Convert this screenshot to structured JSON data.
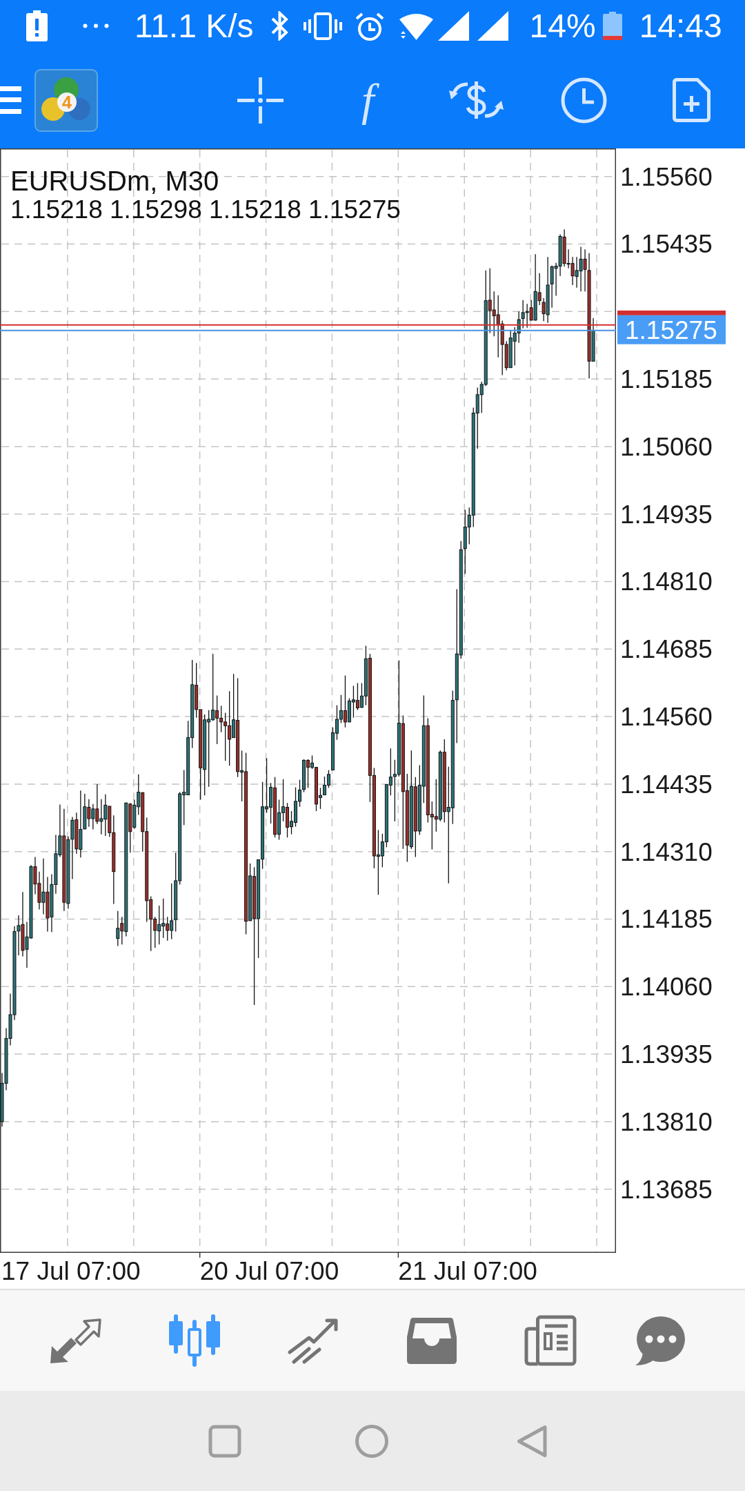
{
  "status_bar": {
    "network_speed": "11.1 K/s",
    "battery_percent": "14%",
    "time": "14:43"
  },
  "toolbar": {
    "logo_badge": "4",
    "function_symbol": "f"
  },
  "chart": {
    "ohlc_readout": "1.15218 1.15298 1.15218 1.15275",
    "time_labels": [
      "17 Jul 07:00",
      "20 Jul 07:00",
      "21 Jul 07:00"
    ],
    "chart_data": {
      "type": "candlestick",
      "title": "EURUSDm, M30",
      "grid": true,
      "categories": [
        null,
        null,
        null,
        null,
        null,
        null,
        null,
        null,
        null,
        null,
        null,
        null,
        null,
        null,
        null,
        null,
        null,
        null,
        null,
        null,
        null,
        null,
        null,
        null,
        null,
        null,
        null,
        null,
        null,
        null,
        null,
        null,
        null,
        null,
        null,
        null,
        null,
        null,
        null,
        null,
        null,
        null,
        null,
        null,
        null,
        null,
        null,
        null,
        null,
        null,
        null,
        null,
        null,
        null,
        null,
        null,
        null,
        null,
        null,
        null,
        null,
        null,
        null,
        null,
        null,
        null,
        null,
        null,
        null,
        null,
        null,
        null,
        null,
        null,
        null,
        null,
        null,
        null,
        null,
        null,
        null,
        null,
        null,
        null,
        null,
        null,
        null,
        null,
        null,
        null,
        null,
        null,
        null,
        null,
        null,
        null,
        null,
        null,
        null,
        null,
        null,
        null,
        null,
        null,
        null,
        null,
        null,
        null,
        null,
        null,
        null,
        null,
        null,
        null,
        null,
        null,
        null,
        null,
        null,
        null,
        null,
        null,
        null,
        null,
        null,
        null,
        null,
        null,
        null,
        null,
        null,
        null,
        null,
        null,
        null,
        null,
        null,
        null,
        null,
        null,
        null,
        null,
        null,
        null,
        null,
        null,
        null,
        null,
        null
      ],
      "ohlc": [
        [
          1.1381,
          1.139,
          1.13801,
          1.13881
        ],
        [
          1.13881,
          1.13983,
          1.13868,
          1.13964
        ],
        [
          1.13964,
          1.14047,
          1.13951,
          1.14008
        ],
        [
          1.14008,
          1.14172,
          1.13998,
          1.14162
        ],
        [
          1.14163,
          1.14192,
          1.14118,
          1.14173
        ],
        [
          1.14175,
          1.14235,
          1.14116,
          1.14127
        ],
        [
          1.14129,
          1.1418,
          1.14095,
          1.14152
        ],
        [
          1.1415,
          1.14285,
          1.14149,
          1.14282
        ],
        [
          1.14282,
          1.143,
          1.14231,
          1.1425
        ],
        [
          1.14251,
          1.14273,
          1.14203,
          1.14216
        ],
        [
          1.14216,
          1.14297,
          1.14194,
          1.14235
        ],
        [
          1.14235,
          1.14263,
          1.14162,
          1.14187
        ],
        [
          1.14189,
          1.14268,
          1.14161,
          1.14249
        ],
        [
          1.14249,
          1.14341,
          1.14232,
          1.14306
        ],
        [
          1.14304,
          1.14397,
          1.143,
          1.14339
        ],
        [
          1.14339,
          1.14389,
          1.142,
          1.14216
        ],
        [
          1.14214,
          1.14338,
          1.14204,
          1.14332
        ],
        [
          1.14333,
          1.14374,
          1.14259,
          1.14368
        ],
        [
          1.14369,
          1.14382,
          1.14306,
          1.14315
        ],
        [
          1.14314,
          1.14423,
          1.14299,
          1.14351
        ],
        [
          1.14352,
          1.14417,
          1.14351,
          1.14393
        ],
        [
          1.14392,
          1.14407,
          1.14356,
          1.14371
        ],
        [
          1.14371,
          1.14398,
          1.14351,
          1.14389
        ],
        [
          1.14389,
          1.14435,
          1.14361,
          1.14366
        ],
        [
          1.14366,
          1.14407,
          1.14342,
          1.14371
        ],
        [
          1.1437,
          1.14416,
          1.14339,
          1.14396
        ],
        [
          1.14394,
          1.14394,
          1.14337,
          1.14345
        ],
        [
          1.14345,
          1.14377,
          1.14213,
          1.14273
        ],
        [
          1.14149,
          1.142,
          1.14135,
          1.14168
        ],
        [
          1.14177,
          1.14189,
          1.14138,
          1.14163
        ],
        [
          1.14162,
          1.14401,
          1.14153,
          1.144
        ],
        [
          1.14398,
          1.144,
          1.14308,
          1.14347
        ],
        [
          1.14355,
          1.14406,
          1.14352,
          1.14396
        ],
        [
          1.14393,
          1.14453,
          1.14378,
          1.1442
        ],
        [
          1.14419,
          1.1442,
          1.1431,
          1.14347
        ],
        [
          1.14347,
          1.14373,
          1.1418,
          1.14219
        ],
        [
          1.14221,
          1.14227,
          1.14126,
          1.14185
        ],
        [
          1.14185,
          1.14189,
          1.14132,
          1.14164
        ],
        [
          1.14163,
          1.1421,
          1.14138,
          1.14175
        ],
        [
          1.14172,
          1.14223,
          1.1415,
          1.14177
        ],
        [
          1.14176,
          1.14189,
          1.14145,
          1.14164
        ],
        [
          1.14164,
          1.14251,
          1.14148,
          1.14182
        ],
        [
          1.14184,
          1.14308,
          1.14162,
          1.14256
        ],
        [
          1.14256,
          1.1442,
          1.14249,
          1.14417
        ],
        [
          1.14415,
          1.14461,
          1.14359,
          1.1442
        ],
        [
          1.14415,
          1.14552,
          1.14415,
          1.14521
        ],
        [
          1.14521,
          1.14665,
          1.14502,
          1.14619
        ],
        [
          1.14618,
          1.14659,
          1.14558,
          1.14573
        ],
        [
          1.14573,
          1.14573,
          1.14406,
          1.14465
        ],
        [
          1.14462,
          1.14564,
          1.14414,
          1.14554
        ],
        [
          1.1455,
          1.14572,
          1.1443,
          1.14555
        ],
        [
          1.14554,
          1.14676,
          1.14552,
          1.14572
        ],
        [
          1.14571,
          1.14599,
          1.14509,
          1.14557
        ],
        [
          1.14557,
          1.1458,
          1.14531,
          1.1455
        ],
        [
          1.1455,
          1.14567,
          1.14478,
          1.14543
        ],
        [
          1.14543,
          1.14607,
          1.14469,
          1.14518
        ],
        [
          1.14521,
          1.14639,
          1.14521,
          1.14554
        ],
        [
          1.14553,
          1.14631,
          1.14448,
          1.14458
        ],
        [
          1.14457,
          1.14497,
          1.14403,
          1.1446
        ],
        [
          1.14458,
          1.14493,
          1.14157,
          1.14181
        ],
        [
          1.14182,
          1.14288,
          1.14182,
          1.14265
        ],
        [
          1.14264,
          1.14281,
          1.14026,
          1.14186
        ],
        [
          1.14186,
          1.14295,
          1.14113,
          1.14295
        ],
        [
          1.14296,
          1.14439,
          1.14278,
          1.14393
        ],
        [
          1.14389,
          1.14483,
          1.14382,
          1.14393
        ],
        [
          1.14392,
          1.14437,
          1.14362,
          1.14429
        ],
        [
          1.14428,
          1.14448,
          1.14336,
          1.14342
        ],
        [
          1.14342,
          1.14406,
          1.14332,
          1.14382
        ],
        [
          1.14382,
          1.14444,
          1.14366,
          1.14393
        ],
        [
          1.14392,
          1.144,
          1.14336,
          1.14355
        ],
        [
          1.14356,
          1.14385,
          1.14342,
          1.14366
        ],
        [
          1.14364,
          1.14429,
          1.14356,
          1.14403
        ],
        [
          1.14403,
          1.14443,
          1.14393,
          1.14424
        ],
        [
          1.14425,
          1.14481,
          1.1442,
          1.14479
        ],
        [
          1.14479,
          1.14481,
          1.14428,
          1.14466
        ],
        [
          1.14466,
          1.14488,
          1.14463,
          1.14474
        ],
        [
          1.14466,
          1.14466,
          1.14385,
          1.14398
        ],
        [
          1.1441,
          1.14428,
          1.14389,
          1.14414
        ],
        [
          1.14415,
          1.14449,
          1.14415,
          1.14433
        ],
        [
          1.14433,
          1.14461,
          1.14428,
          1.14453
        ],
        [
          1.14461,
          1.1454,
          1.14461,
          1.1453
        ],
        [
          1.14529,
          1.14581,
          1.14517,
          1.14555
        ],
        [
          1.14555,
          1.146,
          1.14548,
          1.14571
        ],
        [
          1.14571,
          1.14636,
          1.1454,
          1.1455
        ],
        [
          1.1455,
          1.14594,
          1.1455,
          1.14589
        ],
        [
          1.14587,
          1.14617,
          1.14558,
          1.14591
        ],
        [
          1.1459,
          1.14622,
          1.14572,
          1.14576
        ],
        [
          1.14577,
          1.14622,
          1.14576,
          1.14598
        ],
        [
          1.14598,
          1.14691,
          1.14581,
          1.14667
        ],
        [
          1.14668,
          1.14676,
          1.14402,
          1.14451
        ],
        [
          1.14451,
          1.14465,
          1.14279,
          1.14302
        ],
        [
          1.14301,
          1.1435,
          1.1423,
          1.14304
        ],
        [
          1.14302,
          1.14343,
          1.14281,
          1.14328
        ],
        [
          1.14328,
          1.14435,
          1.14318,
          1.14434
        ],
        [
          1.14433,
          1.14501,
          1.14414,
          1.14448
        ],
        [
          1.14449,
          1.1448,
          1.14366,
          1.14453
        ],
        [
          1.14453,
          1.14664,
          1.14449,
          1.14548
        ],
        [
          1.14547,
          1.14562,
          1.14315,
          1.14421
        ],
        [
          1.14423,
          1.14454,
          1.14291,
          1.14322
        ],
        [
          1.14319,
          1.14497,
          1.14315,
          1.14431
        ],
        [
          1.1443,
          1.14448,
          1.143,
          1.14348
        ],
        [
          1.14348,
          1.1447,
          1.14341,
          1.14433
        ],
        [
          1.14431,
          1.14599,
          1.144,
          1.14543
        ],
        [
          1.14543,
          1.14557,
          1.14364,
          1.14378
        ],
        [
          1.14379,
          1.14403,
          1.14314,
          1.14374
        ],
        [
          1.14375,
          1.14444,
          1.14347,
          1.1437
        ],
        [
          1.1437,
          1.14497,
          1.14366,
          1.14494
        ],
        [
          1.14494,
          1.14518,
          1.14364,
          1.14384
        ],
        [
          1.14384,
          1.14467,
          1.14251,
          1.14392
        ],
        [
          1.14391,
          1.14608,
          1.14361,
          1.1459
        ],
        [
          1.14591,
          1.14796,
          1.14511,
          1.14676
        ],
        [
          1.14674,
          1.14885,
          1.14667,
          1.14869
        ],
        [
          1.14871,
          1.14943,
          1.14824,
          1.14911
        ],
        [
          1.14911,
          1.14947,
          1.14879,
          1.14933
        ],
        [
          1.14933,
          1.15132,
          1.14911,
          1.15122
        ],
        [
          1.15122,
          1.15169,
          1.15056,
          1.15156
        ],
        [
          1.15156,
          1.1518,
          1.15122,
          1.15175
        ],
        [
          1.15175,
          1.15386,
          1.15172,
          1.1533
        ],
        [
          1.15331,
          1.1539,
          1.1527,
          1.15312
        ],
        [
          1.15313,
          1.15347,
          1.15264,
          1.15302
        ],
        [
          1.15304,
          1.1534,
          1.15225,
          1.15285
        ],
        [
          1.15287,
          1.15293,
          1.15192,
          1.15249
        ],
        [
          1.15249,
          1.15255,
          1.15201,
          1.15206
        ],
        [
          1.15206,
          1.15275,
          1.15206,
          1.15261
        ],
        [
          1.15255,
          1.15281,
          1.1521,
          1.1527
        ],
        [
          1.1527,
          1.1531,
          1.15252,
          1.15295
        ],
        [
          1.15297,
          1.15331,
          1.15279,
          1.15308
        ],
        [
          1.15308,
          1.15324,
          1.1528,
          1.1531
        ],
        [
          1.15317,
          1.15331,
          1.15293,
          1.15294
        ],
        [
          1.15294,
          1.15416,
          1.15293,
          1.15347
        ],
        [
          1.15345,
          1.15381,
          1.15322,
          1.1533
        ],
        [
          1.15327,
          1.15335,
          1.15292,
          1.15306
        ],
        [
          1.15304,
          1.15411,
          1.15289,
          1.15359
        ],
        [
          1.15361,
          1.15395,
          1.15317,
          1.15393
        ],
        [
          1.1539,
          1.154,
          1.15339,
          1.15394
        ],
        [
          1.15394,
          1.15453,
          1.15376,
          1.15449
        ],
        [
          1.15448,
          1.15462,
          1.15393,
          1.15399
        ],
        [
          1.15398,
          1.15425,
          1.1539,
          1.15399
        ],
        [
          1.15399,
          1.15411,
          1.15359,
          1.15376
        ],
        [
          1.15375,
          1.15411,
          1.15354,
          1.15386
        ],
        [
          1.15385,
          1.1543,
          1.15347,
          1.15407
        ],
        [
          1.15407,
          1.15425,
          1.15347,
          1.15388
        ],
        [
          1.15386,
          1.15418,
          1.15186,
          1.15218
        ],
        [
          1.15218,
          1.15298,
          1.15218,
          1.15275
        ],
        null,
        null,
        null,
        null,
        null
      ],
      "ylim": [
        1.13567,
        1.15612
      ],
      "yticks": [
        {
          "value": 1.1556,
          "label": "1.15560"
        },
        {
          "value": 1.15435,
          "label": "1.15435"
        },
        {
          "value": 1.15185,
          "label": "1.15185"
        },
        {
          "value": 1.1506,
          "label": "1.15060"
        },
        {
          "value": 1.14935,
          "label": "1.14935"
        },
        {
          "value": 1.1481,
          "label": "1.14810"
        },
        {
          "value": 1.14685,
          "label": "1.14685"
        },
        {
          "value": 1.1456,
          "label": "1.14560"
        },
        {
          "value": 1.14435,
          "label": "1.14435"
        },
        {
          "value": 1.1431,
          "label": "1.14310"
        },
        {
          "value": 1.14185,
          "label": "1.14185"
        },
        {
          "value": 1.1406,
          "label": "1.14060"
        },
        {
          "value": 1.13935,
          "label": "1.13935"
        },
        {
          "value": 1.1381,
          "label": "1.13810"
        },
        {
          "value": 1.13685,
          "label": "1.13685"
        }
      ],
      "ref_lines": [
        {
          "axis": "y",
          "value": 1.15285,
          "color": "#d32f2f"
        },
        {
          "axis": "y",
          "value": 1.15275,
          "color": "#4a90e2",
          "label": "1.15275"
        }
      ]
    }
  },
  "bottom_nav": {
    "items": [
      {
        "kind": "arrows",
        "selected": false
      },
      {
        "kind": "candles",
        "selected": true
      },
      {
        "kind": "trend",
        "selected": false
      },
      {
        "kind": "tray",
        "selected": false
      },
      {
        "kind": "newspaper",
        "selected": false
      },
      {
        "kind": "chat",
        "selected": false
      }
    ]
  }
}
